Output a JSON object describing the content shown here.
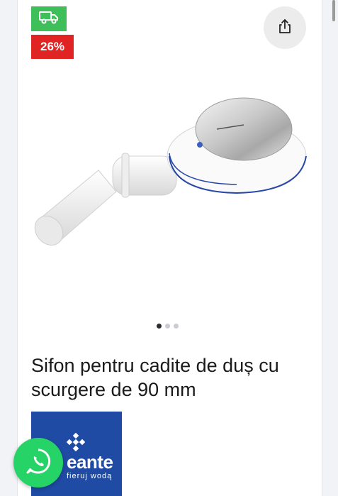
{
  "badges": {
    "delivery_icon": "delivery-truck-icon",
    "discount_label": "26%"
  },
  "actions": {
    "share_icon": "share-icon"
  },
  "gallery": {
    "image_alt": "shower drain siphon",
    "slide_count": 3,
    "active_slide": 1
  },
  "product": {
    "title": "Sifon pentru cadite de duș cu scurgere de 90 mm"
  },
  "brand": {
    "name": "eante",
    "tagline": "fieruj wodą"
  },
  "colors": {
    "delivery_badge": "#3fbf5a",
    "discount_badge": "#e02424",
    "brand_bg": "#1f4ba5",
    "whatsapp": "#25d366"
  },
  "chat": {
    "icon": "whatsapp-icon"
  }
}
